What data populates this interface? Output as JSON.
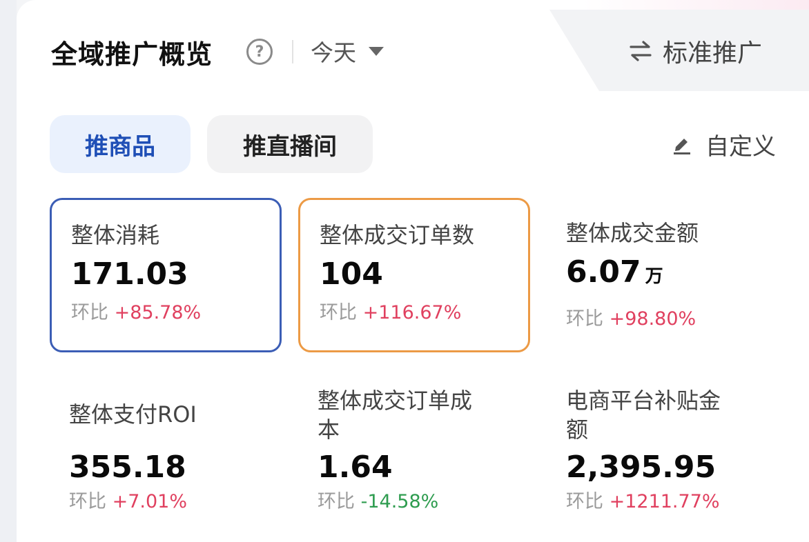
{
  "header": {
    "title": "全域推广概览",
    "help": "?",
    "date_range": "今天",
    "switch_label": "标准推广"
  },
  "tabs": [
    {
      "label": "推商品",
      "active": true
    },
    {
      "label": "推直播间",
      "active": false
    }
  ],
  "customize_label": "自定义",
  "change_prefix": "环比",
  "metrics": [
    {
      "label": "整体消耗",
      "value": "171.03",
      "unit": "",
      "change": "+85.78%",
      "trend": "up",
      "highlight": "blue"
    },
    {
      "label": "整体成交订单数",
      "value": "104",
      "unit": "",
      "change": "+116.67%",
      "trend": "up",
      "highlight": "orange"
    },
    {
      "label": "整体成交金额",
      "value": "6.07",
      "unit": "万",
      "change": "+98.80%",
      "trend": "up",
      "highlight": ""
    },
    {
      "label": "整体支付ROI",
      "value": "355.18",
      "unit": "",
      "change": "+7.01%",
      "trend": "up",
      "highlight": ""
    },
    {
      "label_line1": "整体成交订单成",
      "label_line2": "本",
      "value": "1.64",
      "unit": "",
      "change": "-14.58%",
      "trend": "down",
      "highlight": ""
    },
    {
      "label_line1": "电商平台补贴金",
      "label_line2": "额",
      "value": "2,395.95",
      "unit": "",
      "change": "+1211.77%",
      "trend": "up",
      "highlight": ""
    }
  ],
  "colors": {
    "accent_blue": "#1f4fb6",
    "highlight_blue": "#3b5db5",
    "highlight_orange": "#ec9a45",
    "positive": "#e0405f",
    "negative": "#2e9c4f"
  }
}
